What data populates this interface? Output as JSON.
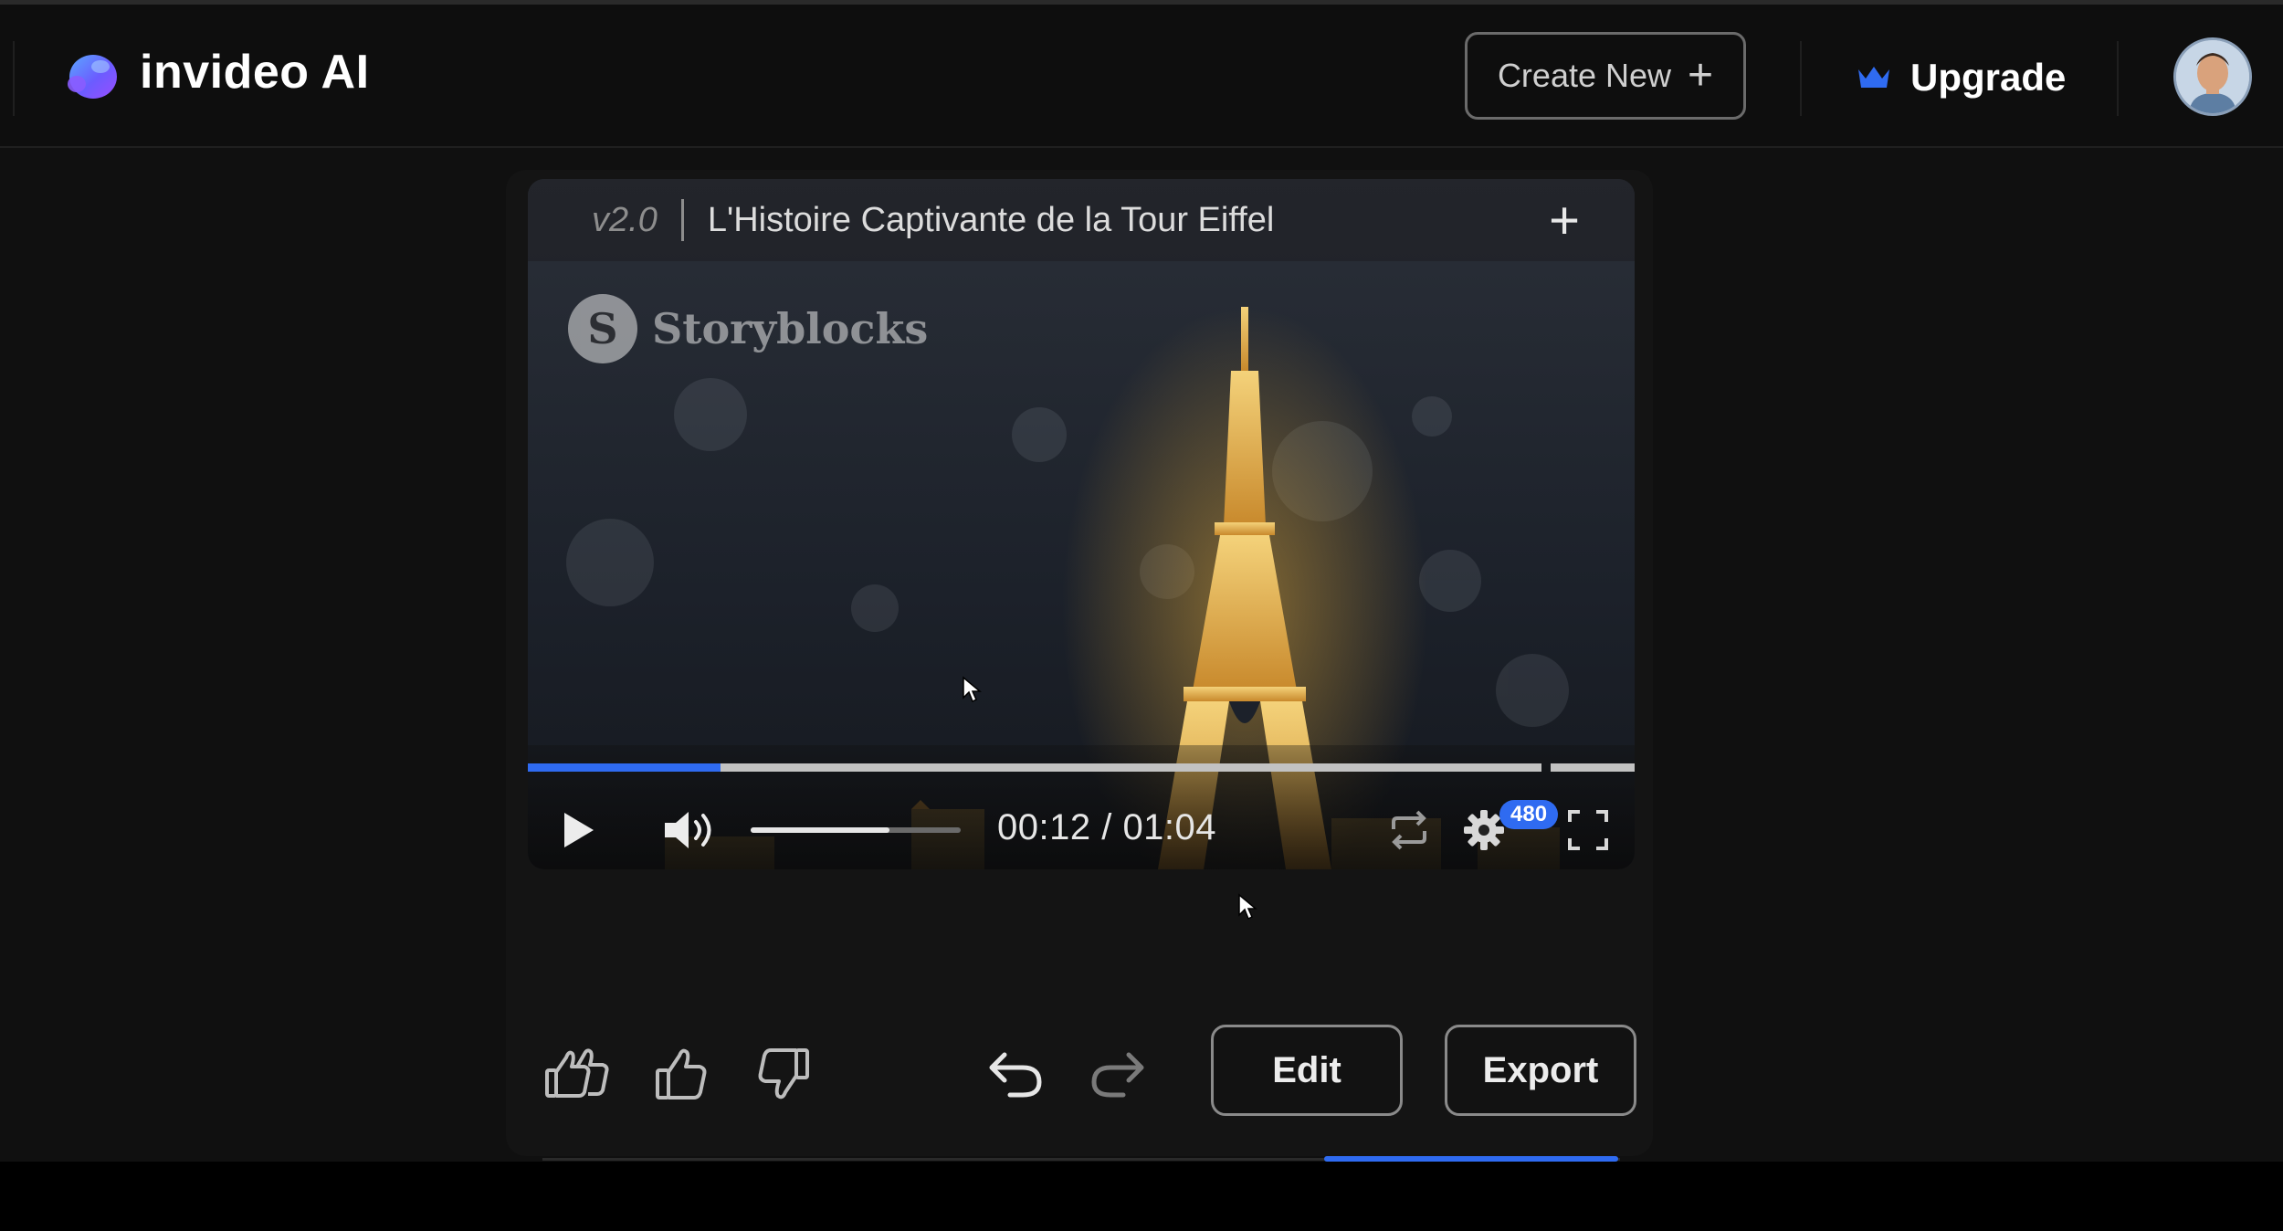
{
  "app": {
    "logo_text": "invideo AI",
    "create_new_label": "Create New",
    "upgrade_label": "Upgrade",
    "accent_color": "#2f6bf1"
  },
  "video": {
    "version": "v2.0",
    "title": "L'Histoire Captivante de la Tour Eiffel",
    "watermark": "Storyblocks",
    "watermark_initial": "S",
    "current_time": "00:12",
    "duration": "01:04",
    "timecode": "00:12 / 01:04",
    "progress_fraction": 0.19,
    "volume_fraction": 0.66,
    "quality_badge": "480"
  },
  "actions": {
    "edit_label": "Edit",
    "export_label": "Export"
  },
  "icons": {
    "logo": "invideo-logo-icon",
    "create_new": "plus-icon",
    "upgrade": "crown-icon",
    "add_version": "plus-icon",
    "play": "play-icon",
    "volume": "volume-icon",
    "loop": "loop-icon",
    "settings": "gear-icon",
    "fullscreen": "fullscreen-icon",
    "super_like": "double-thumbs-up-icon",
    "like": "thumbs-up-icon",
    "dislike": "thumbs-down-icon",
    "undo": "undo-icon",
    "redo": "redo-icon"
  }
}
